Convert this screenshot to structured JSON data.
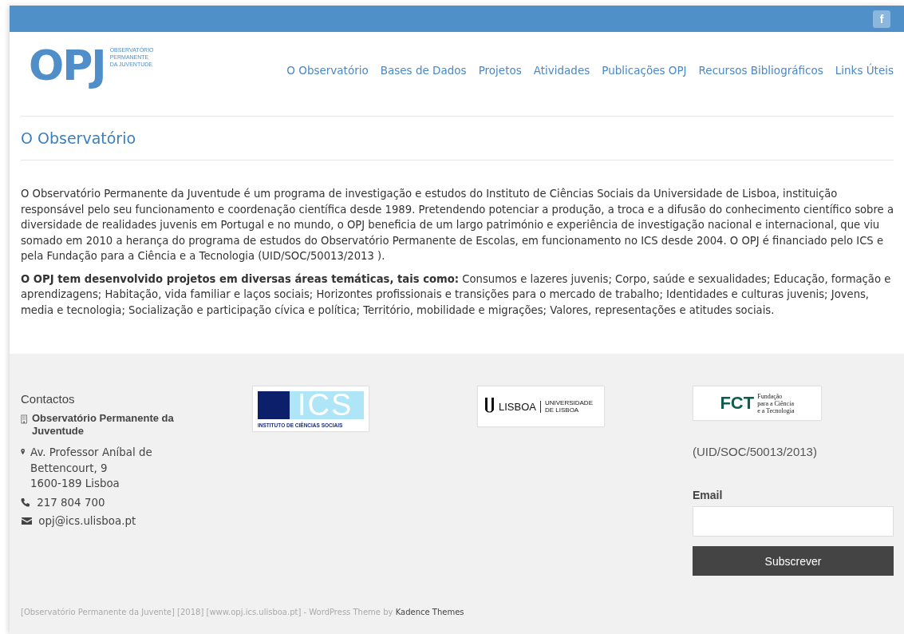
{
  "top_bar": {
    "social": "f"
  },
  "logo": {
    "mark": "OPJ",
    "lines": [
      "OBSERVATÓRIO",
      "PERMANENTE",
      "DA JUVENTUDE"
    ]
  },
  "nav": [
    {
      "label": "O Observatório"
    },
    {
      "label": "Bases de Dados"
    },
    {
      "label": "Projetos"
    },
    {
      "label": "Atividades"
    },
    {
      "label": "Publicações OPJ"
    },
    {
      "label": "Recursos Bibliográficos"
    },
    {
      "label": "Links Úteis"
    }
  ],
  "page_title": "O Observatório",
  "paragraphs": [
    "O Observatório Permanente da Juventude é um programa de investigação e estudos do Instituto de Ciências Sociais da Universidade de Lisboa, instituição responsável pelo seu funcionamento e coordenação científica desde 1989. Pretendendo potenciar a produção, a troca e a difusão do conhecimento científico sobre a diversidade de realidades juvenis em Portugal e no mundo, o OPJ beneficia de um largo património e experiência de investigação nacional e internacional, que viu somado em 2010 a herança do programa de estudos do Observatório Permanente de Escolas, em funcionamento no ICS desde 2004. O OPJ é financiado pelo ICS e pela Fundação para a Ciência e a Tecnologia (UID/SOC/50013/2013 ).",
    "**O OPJ tem desenvolvido projetos em diversas áreas temáticas, tais como:** Consumos e lazeres juvenis; Corpo, saúde e sexualidades; Educação, formação e aprendizagens; Habitação, vida familiar e laços sociais; Horizontes profissionais e transições para o mercado de trabalho; Identidades e culturas juvenis; Jovens, media e tecnologia; Socialização e participação cívica e política; Território, mobilidade e migrações; Valores, representações e atitudes sociais."
  ],
  "footer": {
    "contacts": {
      "title": "Contactos",
      "organization": "Observatório Permanente da Juventude",
      "address": [
        "Av. Professor Aníbal de",
        "Bettencourt, 9",
        "1600-189 Lisboa"
      ],
      "phone": "217 804 700",
      "email": "opj@ics.ulisboa.pt"
    },
    "ics_logo": {
      "mark": "ICS",
      "caption": "INSTITUTO DE CIÊNCIAS SOCIAIS"
    },
    "ulisboa_logo": {
      "mark": "LISBOA",
      "caption": [
        "UNIVERSIDADE",
        "DE LISBOA"
      ]
    },
    "fct_logo": {
      "mark": "FCT",
      "caption": [
        "Fundação",
        "para a Ciência",
        "e a Tecnologia"
      ]
    },
    "fct_code": "(UID/SOC/50013/2013)",
    "newsletter": {
      "label": "Email",
      "button": "Subscrever"
    },
    "credits": {
      "text": "[Observatório Permanente da Juvente] [2018] [www.opj.ics.ulisboa.pt] - WordPress Theme by",
      "link": "Kadence Themes"
    }
  }
}
